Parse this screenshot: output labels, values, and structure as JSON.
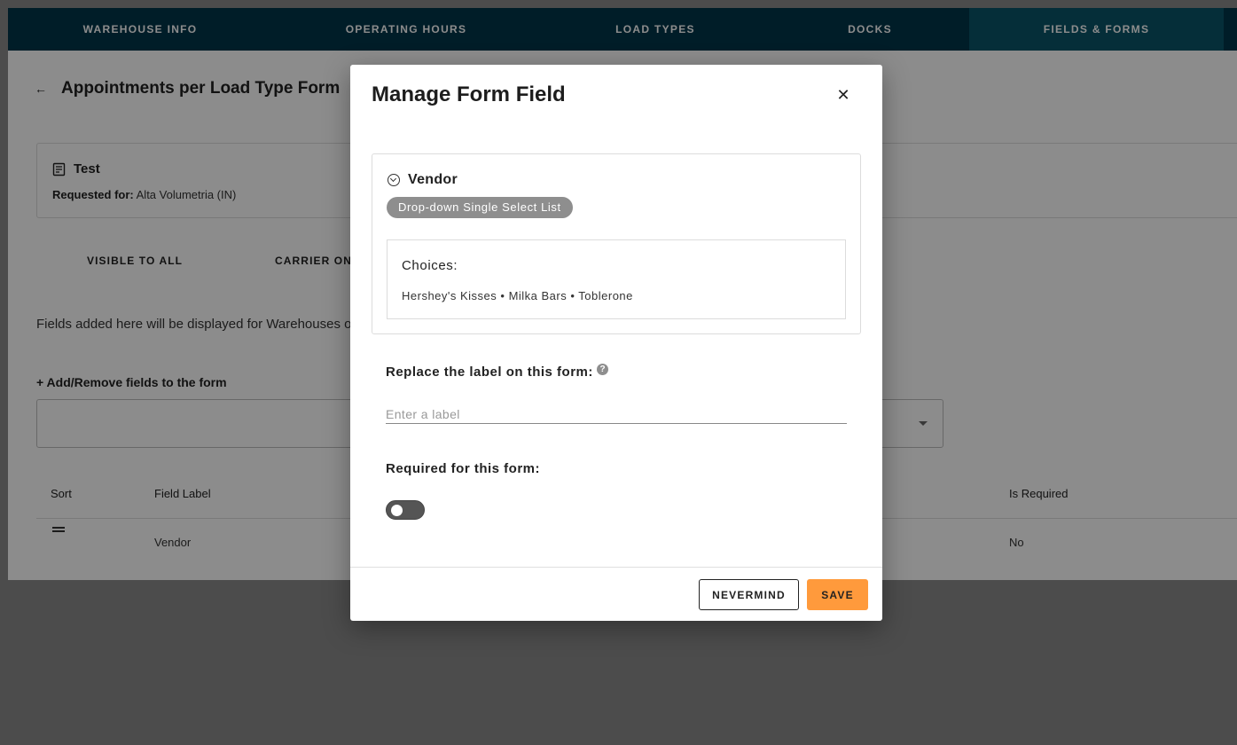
{
  "topnav": {
    "tabs": [
      {
        "label": "WAREHOUSE INFO"
      },
      {
        "label": "OPERATING HOURS"
      },
      {
        "label": "LOAD TYPES"
      },
      {
        "label": "DOCKS"
      },
      {
        "label": "FIELDS & FORMS"
      }
    ],
    "active_tab": "FIELDS & FORMS"
  },
  "page": {
    "title": "Appointments per Load Type Form",
    "form_name": "Test",
    "requested_for_label": "Requested for:",
    "requested_for_value": "Alta Volumetria (IN)",
    "visibility_tabs": [
      {
        "label": "VISIBLE TO ALL"
      },
      {
        "label": "CARRIER ONLY"
      }
    ],
    "info_text": "Fields added here will be displayed for Warehouses o",
    "add_remove_label": "+ Add/Remove fields to the form",
    "table": {
      "headers": {
        "sort": "Sort",
        "field_label": "Field Label",
        "is_required": "Is Required"
      },
      "rows": [
        {
          "field_label": "Vendor",
          "is_required": "No"
        }
      ]
    }
  },
  "modal": {
    "title": "Manage Form Field",
    "field": {
      "name": "Vendor",
      "type": "Drop-down Single Select List",
      "choices_label": "Choices:",
      "choices": "Hershey's Kisses • Milka Bars • Toblerone"
    },
    "replace_label_question": "Replace the label on this form:",
    "label_input": {
      "value": "",
      "placeholder": "Enter a label"
    },
    "required_question": "Required for this form:",
    "required_toggle": false,
    "buttons": {
      "nevermind": "NEVERMIND",
      "save": "SAVE"
    }
  },
  "colors": {
    "nav_bg": "#00364a",
    "nav_active": "#0a5568",
    "save_button": "#ff9a3c",
    "badge_bg": "#8e8e8e"
  }
}
